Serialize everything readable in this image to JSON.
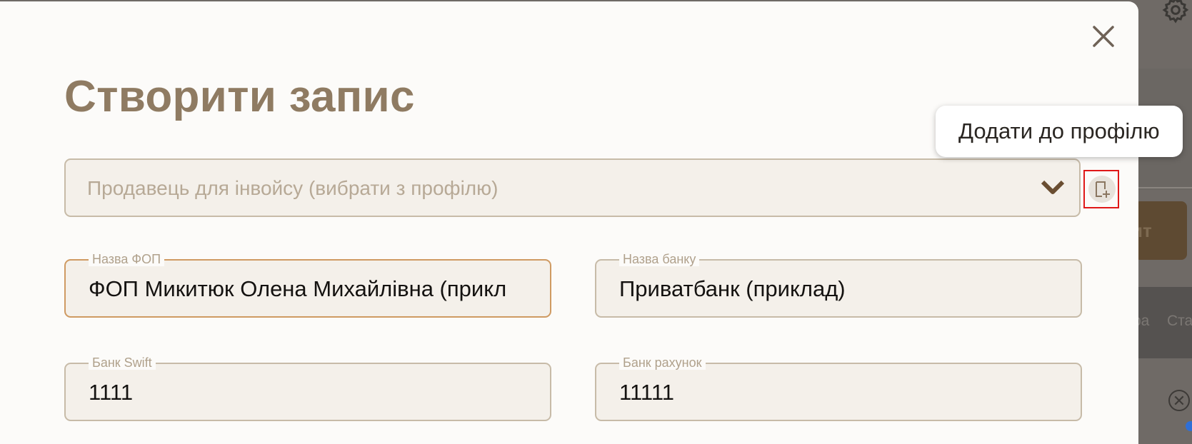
{
  "background": {
    "button_text": "ит",
    "strip_texts": [
      "ра",
      "Ста"
    ],
    "close_symbol": "✕"
  },
  "modal": {
    "title": "Створити запис",
    "close_label": "✕",
    "seller_select": {
      "placeholder": "Продавець для інвойсу (вибрати з профілю)"
    },
    "add_to_profile_tooltip": "Додати до профілю",
    "fields": {
      "fop_name": {
        "label": "Назва ФОП",
        "value": "ФОП Микитюк Олена Михайлівна (прикл"
      },
      "bank_name": {
        "label": "Назва банку",
        "value": "Приватбанк (приклад)"
      },
      "bank_swift": {
        "label": "Банк Swift",
        "value": "1111"
      },
      "bank_account": {
        "label": "Банк рахунок",
        "value": "11111"
      }
    }
  },
  "colors": {
    "title": "#8f7b62",
    "accent_border_focused": "#cf9a62",
    "highlight_box": "#e01818"
  },
  "icons": {
    "close": "close-icon",
    "chevron": "chevron-down-icon",
    "add_profile": "add-document-icon",
    "settings": "gear-icon"
  }
}
